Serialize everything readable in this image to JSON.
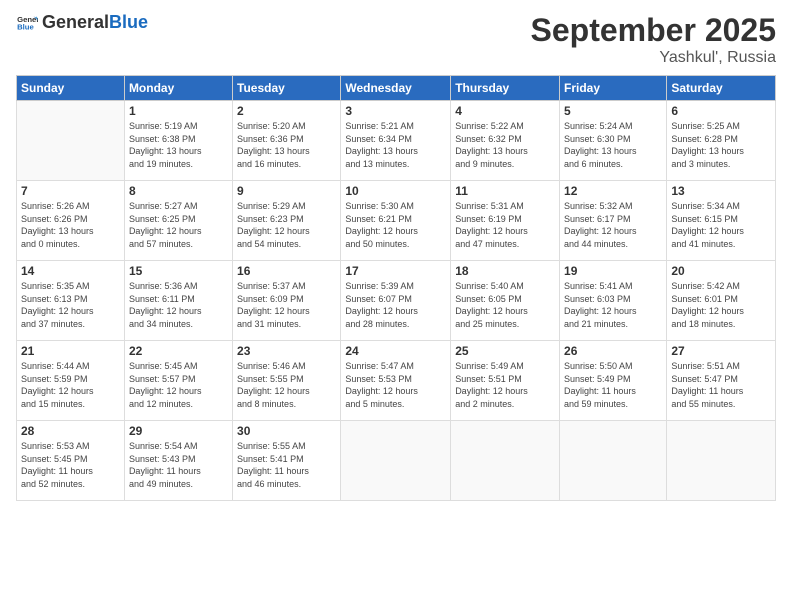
{
  "logo": {
    "text_general": "General",
    "text_blue": "Blue"
  },
  "title": "September 2025",
  "subtitle": "Yashkul', Russia",
  "days_of_week": [
    "Sunday",
    "Monday",
    "Tuesday",
    "Wednesday",
    "Thursday",
    "Friday",
    "Saturday"
  ],
  "weeks": [
    [
      {
        "day": "",
        "info": ""
      },
      {
        "day": "1",
        "info": "Sunrise: 5:19 AM\nSunset: 6:38 PM\nDaylight: 13 hours\nand 19 minutes."
      },
      {
        "day": "2",
        "info": "Sunrise: 5:20 AM\nSunset: 6:36 PM\nDaylight: 13 hours\nand 16 minutes."
      },
      {
        "day": "3",
        "info": "Sunrise: 5:21 AM\nSunset: 6:34 PM\nDaylight: 13 hours\nand 13 minutes."
      },
      {
        "day": "4",
        "info": "Sunrise: 5:22 AM\nSunset: 6:32 PM\nDaylight: 13 hours\nand 9 minutes."
      },
      {
        "day": "5",
        "info": "Sunrise: 5:24 AM\nSunset: 6:30 PM\nDaylight: 13 hours\nand 6 minutes."
      },
      {
        "day": "6",
        "info": "Sunrise: 5:25 AM\nSunset: 6:28 PM\nDaylight: 13 hours\nand 3 minutes."
      }
    ],
    [
      {
        "day": "7",
        "info": "Sunrise: 5:26 AM\nSunset: 6:26 PM\nDaylight: 13 hours\nand 0 minutes."
      },
      {
        "day": "8",
        "info": "Sunrise: 5:27 AM\nSunset: 6:25 PM\nDaylight: 12 hours\nand 57 minutes."
      },
      {
        "day": "9",
        "info": "Sunrise: 5:29 AM\nSunset: 6:23 PM\nDaylight: 12 hours\nand 54 minutes."
      },
      {
        "day": "10",
        "info": "Sunrise: 5:30 AM\nSunset: 6:21 PM\nDaylight: 12 hours\nand 50 minutes."
      },
      {
        "day": "11",
        "info": "Sunrise: 5:31 AM\nSunset: 6:19 PM\nDaylight: 12 hours\nand 47 minutes."
      },
      {
        "day": "12",
        "info": "Sunrise: 5:32 AM\nSunset: 6:17 PM\nDaylight: 12 hours\nand 44 minutes."
      },
      {
        "day": "13",
        "info": "Sunrise: 5:34 AM\nSunset: 6:15 PM\nDaylight: 12 hours\nand 41 minutes."
      }
    ],
    [
      {
        "day": "14",
        "info": "Sunrise: 5:35 AM\nSunset: 6:13 PM\nDaylight: 12 hours\nand 37 minutes."
      },
      {
        "day": "15",
        "info": "Sunrise: 5:36 AM\nSunset: 6:11 PM\nDaylight: 12 hours\nand 34 minutes."
      },
      {
        "day": "16",
        "info": "Sunrise: 5:37 AM\nSunset: 6:09 PM\nDaylight: 12 hours\nand 31 minutes."
      },
      {
        "day": "17",
        "info": "Sunrise: 5:39 AM\nSunset: 6:07 PM\nDaylight: 12 hours\nand 28 minutes."
      },
      {
        "day": "18",
        "info": "Sunrise: 5:40 AM\nSunset: 6:05 PM\nDaylight: 12 hours\nand 25 minutes."
      },
      {
        "day": "19",
        "info": "Sunrise: 5:41 AM\nSunset: 6:03 PM\nDaylight: 12 hours\nand 21 minutes."
      },
      {
        "day": "20",
        "info": "Sunrise: 5:42 AM\nSunset: 6:01 PM\nDaylight: 12 hours\nand 18 minutes."
      }
    ],
    [
      {
        "day": "21",
        "info": "Sunrise: 5:44 AM\nSunset: 5:59 PM\nDaylight: 12 hours\nand 15 minutes."
      },
      {
        "day": "22",
        "info": "Sunrise: 5:45 AM\nSunset: 5:57 PM\nDaylight: 12 hours\nand 12 minutes."
      },
      {
        "day": "23",
        "info": "Sunrise: 5:46 AM\nSunset: 5:55 PM\nDaylight: 12 hours\nand 8 minutes."
      },
      {
        "day": "24",
        "info": "Sunrise: 5:47 AM\nSunset: 5:53 PM\nDaylight: 12 hours\nand 5 minutes."
      },
      {
        "day": "25",
        "info": "Sunrise: 5:49 AM\nSunset: 5:51 PM\nDaylight: 12 hours\nand 2 minutes."
      },
      {
        "day": "26",
        "info": "Sunrise: 5:50 AM\nSunset: 5:49 PM\nDaylight: 11 hours\nand 59 minutes."
      },
      {
        "day": "27",
        "info": "Sunrise: 5:51 AM\nSunset: 5:47 PM\nDaylight: 11 hours\nand 55 minutes."
      }
    ],
    [
      {
        "day": "28",
        "info": "Sunrise: 5:53 AM\nSunset: 5:45 PM\nDaylight: 11 hours\nand 52 minutes."
      },
      {
        "day": "29",
        "info": "Sunrise: 5:54 AM\nSunset: 5:43 PM\nDaylight: 11 hours\nand 49 minutes."
      },
      {
        "day": "30",
        "info": "Sunrise: 5:55 AM\nSunset: 5:41 PM\nDaylight: 11 hours\nand 46 minutes."
      },
      {
        "day": "",
        "info": ""
      },
      {
        "day": "",
        "info": ""
      },
      {
        "day": "",
        "info": ""
      },
      {
        "day": "",
        "info": ""
      }
    ]
  ]
}
